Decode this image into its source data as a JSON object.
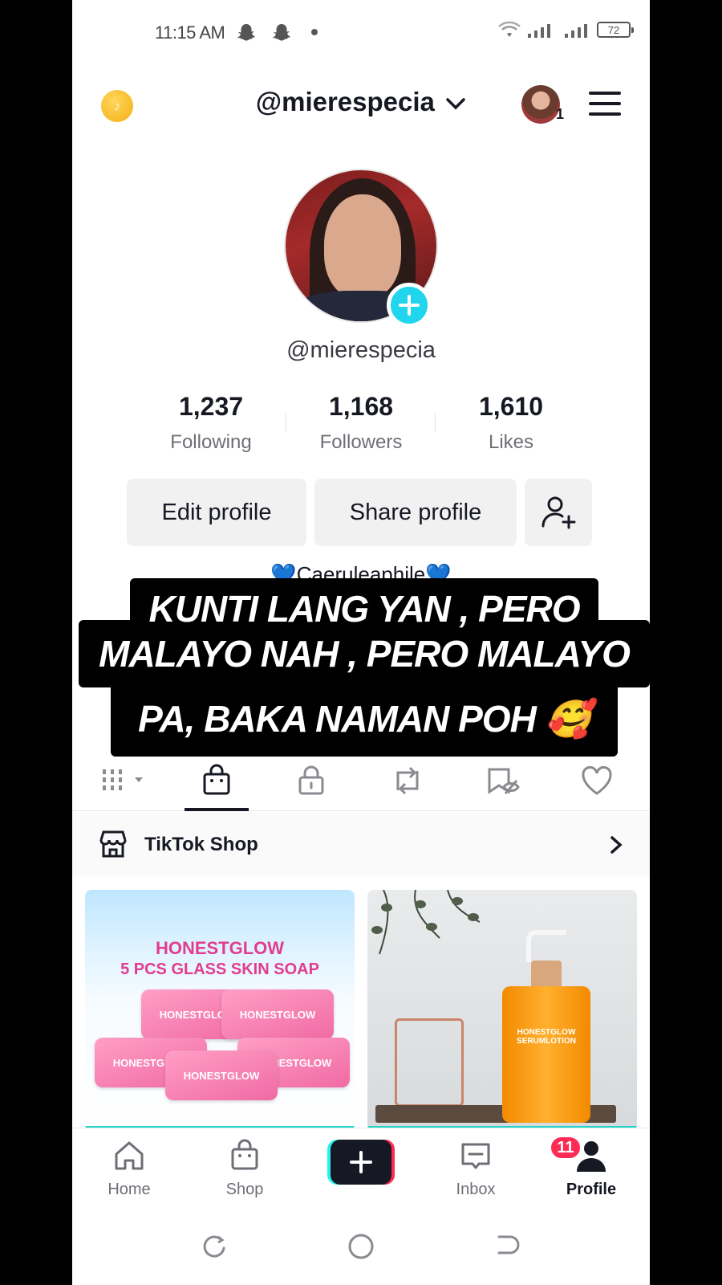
{
  "status_bar": {
    "time": "11:15 AM",
    "battery": "72",
    "icons": [
      "snapchat-icon",
      "snapchat-icon",
      "notification-dot",
      "wifi-icon",
      "signal-icon",
      "battery-icon"
    ]
  },
  "header": {
    "username": "@mierespecia",
    "account_badge": "1",
    "icons": [
      "coin-icon",
      "chevron-down-icon",
      "avatar",
      "menu-icon"
    ]
  },
  "profile": {
    "username": "@mierespecia",
    "stats": [
      {
        "value": "1,237",
        "label": "Following"
      },
      {
        "value": "1,168",
        "label": "Followers"
      },
      {
        "value": "1,610",
        "label": "Likes"
      }
    ],
    "edit_label": "Edit profile",
    "share_label": "Share profile",
    "bio": "💙Caeruleaphile💙"
  },
  "overlay_caption": {
    "line1": "KUNTI LANG YAN , PERO",
    "line2": "MALAYO NAH , PERO MALAYO",
    "line3": "PA, BAKA NAMAN POH 🥰"
  },
  "tabs": {
    "items": [
      "videos-grid-icon",
      "shop-bag-icon",
      "lock-icon",
      "repost-icon",
      "favorites-icon",
      "heart-icon"
    ],
    "active": "shop-bag-icon"
  },
  "shop": {
    "label": "TikTok Shop"
  },
  "products": [
    {
      "brand": "HONESTGLOW",
      "title": "5 PCS GLASS SKIN SOAP",
      "soap_label": "HONESTGLOW"
    },
    {
      "bottle_label": "HONESTGLOW SERUMLOTION"
    }
  ],
  "bottom_nav": {
    "items": [
      {
        "label": "Home"
      },
      {
        "label": "Shop"
      },
      {
        "label": ""
      },
      {
        "label": "Inbox"
      },
      {
        "label": "Profile"
      }
    ],
    "inbox_badge": "11",
    "active": "Profile"
  },
  "colors": {
    "accent_cyan": "#20d5ec",
    "badge_red": "#fe2c55",
    "text_primary": "#161823",
    "text_secondary": "#6e6f76"
  }
}
